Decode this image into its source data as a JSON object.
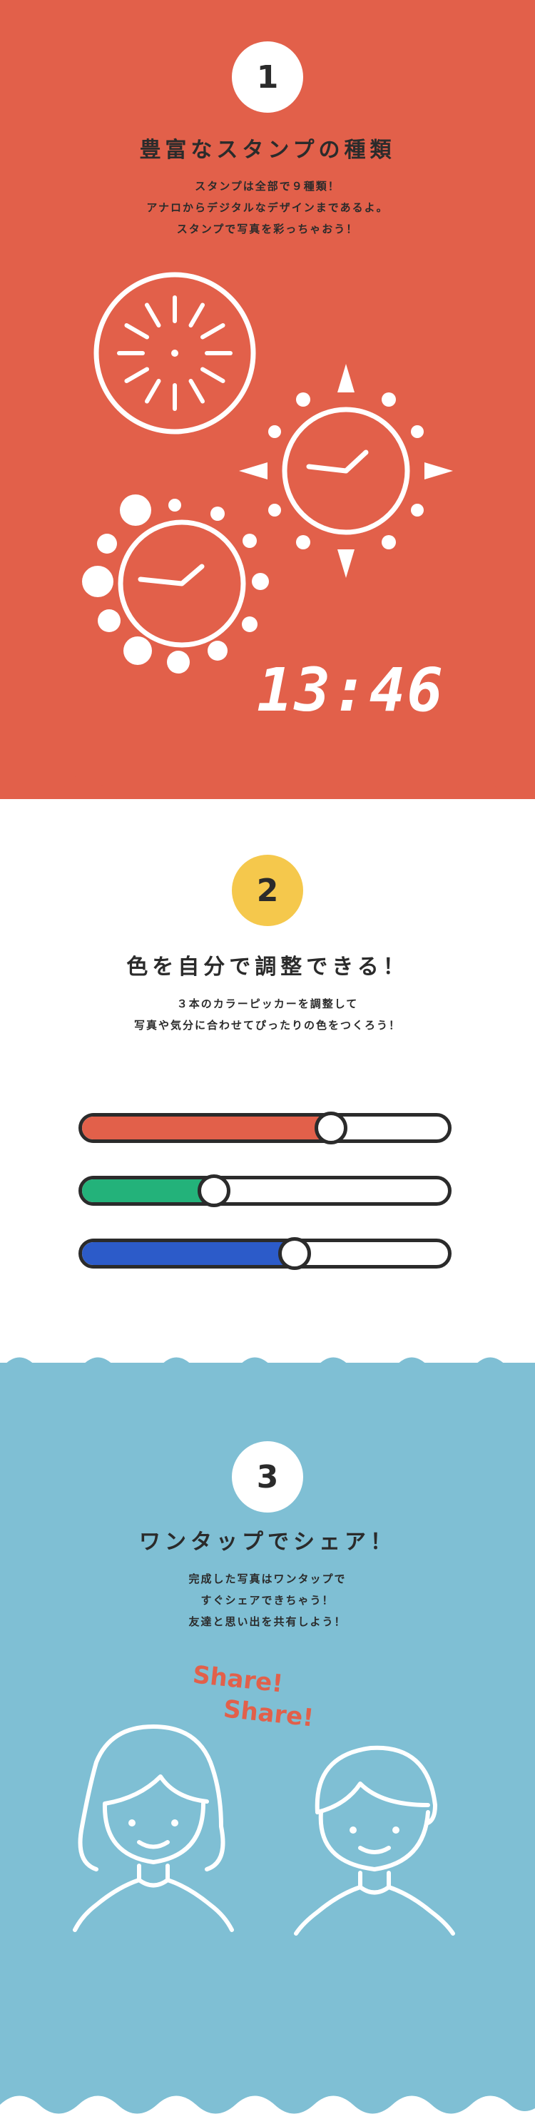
{
  "section1": {
    "number": "1",
    "title": "豊富なスタンプの種類",
    "lines": [
      "スタンプは全部で９種類！",
      "アナロからデジタルなデザインまであるよ。",
      "スタンプで写真を彩っちゃおう！"
    ],
    "digital_clock": "13:46",
    "background": "#E2604A"
  },
  "section2": {
    "number": "2",
    "title": "色を自分で調整できる！",
    "lines": [
      "３本のカラーピッカーを調整して",
      "写真や気分に合わせてぴったりの色をつくろう！"
    ],
    "badge_color": "#F5C84C",
    "sliders": [
      {
        "name": "red",
        "color": "#E2604A",
        "value": 0.68
      },
      {
        "name": "green",
        "color": "#23B27A",
        "value": 0.36
      },
      {
        "name": "blue",
        "color": "#2C5BC9",
        "value": 0.58
      }
    ]
  },
  "section3": {
    "number": "3",
    "title": "ワンタップでシェア！",
    "lines": [
      "完成した写真はワンタップで",
      "すぐシェアできちゃう！",
      "友達と思い出を共有しよう！"
    ],
    "share_labels": [
      "Share!",
      "Share!"
    ],
    "background": "#7FBFD4"
  }
}
